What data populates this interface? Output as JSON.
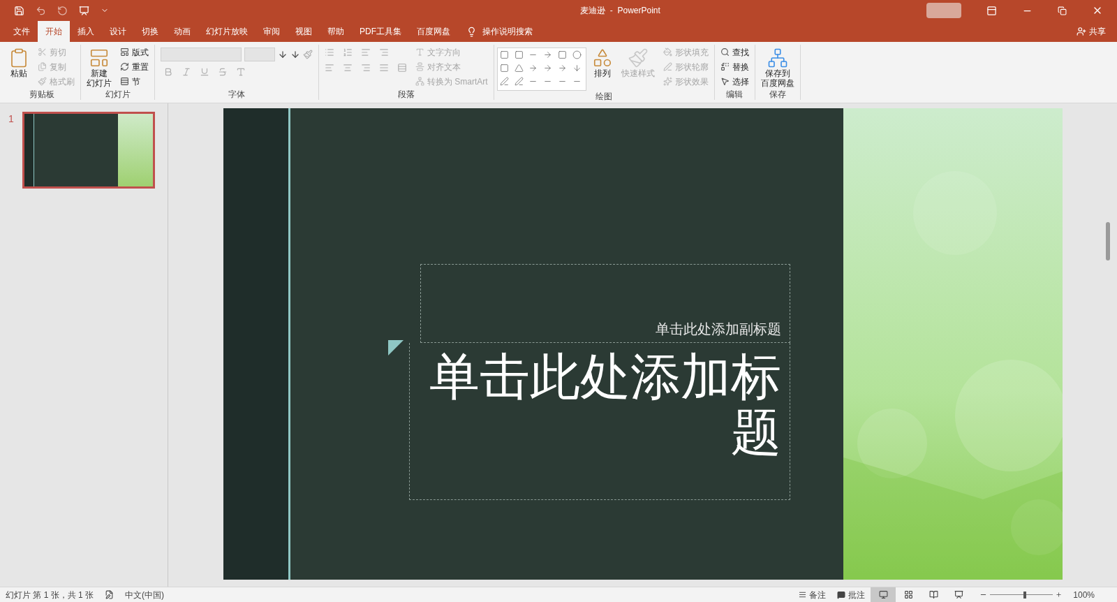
{
  "window": {
    "title": "麦迪逊  -  PowerPoint"
  },
  "menu_tabs": [
    {
      "label": "文件",
      "selected": false
    },
    {
      "label": "开始",
      "selected": true
    },
    {
      "label": "插入",
      "selected": false
    },
    {
      "label": "设计",
      "selected": false
    },
    {
      "label": "切换",
      "selected": false
    },
    {
      "label": "动画",
      "selected": false
    },
    {
      "label": "幻灯片放映",
      "selected": false
    },
    {
      "label": "审阅",
      "selected": false
    },
    {
      "label": "视图",
      "selected": false
    },
    {
      "label": "帮助",
      "selected": false
    },
    {
      "label": "PDF工具集",
      "selected": false
    },
    {
      "label": "百度网盘",
      "selected": false
    }
  ],
  "tell_me": "操作说明搜索",
  "share": "共享",
  "ribbon": [
    {
      "label": "剪贴板",
      "kind": "plain",
      "items": [
        {
          "kind": "big",
          "lines": [
            "粘贴"
          ],
          "disabled": false
        },
        {
          "kind": "small",
          "label": "剪切",
          "disabled": true
        },
        {
          "kind": "small",
          "label": "复制",
          "disabled": true
        },
        {
          "kind": "small",
          "label": "格式刷",
          "disabled": true
        }
      ]
    },
    {
      "label": "幻灯片",
      "kind": "plain",
      "items": [
        {
          "kind": "big",
          "lines": [
            "新建",
            "幻灯片"
          ],
          "disabled": false
        },
        {
          "kind": "small",
          "label": "版式",
          "disabled": false
        },
        {
          "kind": "small",
          "label": "重置",
          "disabled": false
        },
        {
          "kind": "small",
          "label": "节",
          "disabled": false
        }
      ]
    },
    {
      "label": "字体",
      "kind": "font"
    },
    {
      "label": "段落",
      "kind": "paragraph",
      "items": [
        {
          "kind": "small",
          "label": "文字方向",
          "disabled": true
        },
        {
          "kind": "small",
          "label": "对齐文本",
          "disabled": true
        },
        {
          "kind": "small",
          "label": "转换为 SmartArt",
          "disabled": true
        }
      ]
    },
    {
      "label": "绘图",
      "kind": "drawing",
      "items": [
        {
          "kind": "big",
          "lines": [
            "排列"
          ],
          "disabled": false
        },
        {
          "kind": "big",
          "lines": [
            "快速样式"
          ],
          "disabled": true
        },
        {
          "kind": "small",
          "label": "形状填充",
          "disabled": true
        },
        {
          "kind": "small",
          "label": "形状轮廓",
          "disabled": true
        },
        {
          "kind": "small",
          "label": "形状效果",
          "disabled": true
        }
      ]
    },
    {
      "label": "编辑",
      "kind": "plain",
      "items": [
        {
          "kind": "small",
          "label": "查找",
          "disabled": false
        },
        {
          "kind": "small",
          "label": "替换",
          "disabled": false
        },
        {
          "kind": "small",
          "label": "选择",
          "disabled": false
        }
      ]
    },
    {
      "label": "保存",
      "kind": "plain",
      "items": [
        {
          "kind": "big",
          "lines": [
            "保存到",
            "百度网盘"
          ],
          "disabled": false
        }
      ]
    }
  ],
  "thumbnails": [
    {
      "number": "1",
      "selected": true
    }
  ],
  "slide": {
    "subtitle": "单击此处添加副标题",
    "title": "单击此处添加标题"
  },
  "status_bar": {
    "slide_info": "幻灯片 第 1 张，共 1 张",
    "language": "中文(中国)",
    "notes": "备注",
    "comments": "批注",
    "views": [
      {
        "kind": "normal",
        "selected": true
      },
      {
        "kind": "sorter",
        "selected": false
      },
      {
        "kind": "reading",
        "selected": false
      },
      {
        "kind": "show",
        "selected": false
      }
    ],
    "zoom": {
      "level": 0.55
    },
    "zoom_text": "100%"
  }
}
